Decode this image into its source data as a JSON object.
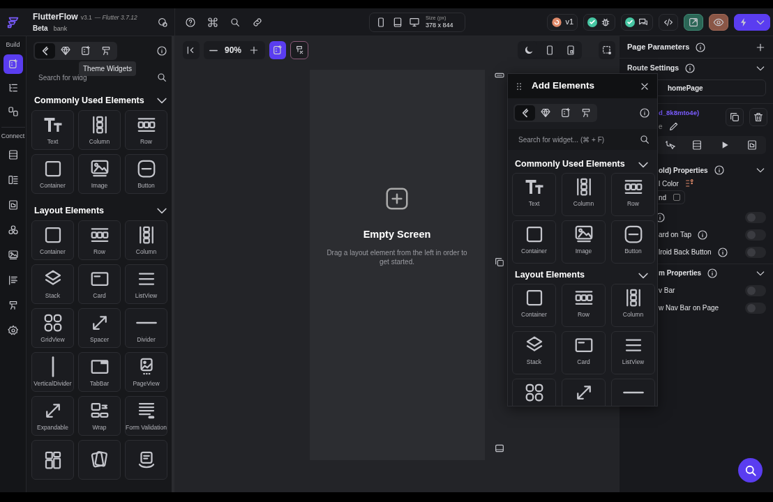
{
  "header": {
    "app_name": "FlutterFlow",
    "version": "v3.1",
    "flutter_version": "— Flutter 3.7.12",
    "tag": "Beta",
    "project": "bank"
  },
  "device_selector": {
    "size_label": "Size (px)",
    "size": "378 x 844"
  },
  "version_badge": "v1",
  "left_rail": [
    {
      "label": "Build",
      "items": [
        {
          "kind": "widgets",
          "selected": true
        },
        {
          "kind": "tree",
          "selected": false
        },
        {
          "kind": "storyboard",
          "selected": false
        }
      ]
    },
    {
      "label": "Connect",
      "items": [
        {
          "kind": "database",
          "selected": false
        },
        {
          "kind": "api",
          "selected": false
        },
        {
          "kind": "storage",
          "selected": false
        },
        {
          "kind": "integrations",
          "selected": false
        },
        {
          "kind": "media",
          "selected": false
        },
        {
          "kind": "content",
          "selected": false
        },
        {
          "kind": "theme",
          "selected": false
        },
        {
          "kind": "settings",
          "selected": false
        }
      ]
    }
  ],
  "widget_panel": {
    "tabs": [
      {
        "kind": "flutter",
        "selected": true
      },
      {
        "kind": "diamond",
        "selected": false
      },
      {
        "kind": "custom",
        "selected": false
      },
      {
        "kind": "theme",
        "selected": false
      }
    ],
    "tooltip": "Theme Widgets",
    "search": {
      "placeholder": "Search for widg"
    },
    "sections": [
      {
        "title": "Commonly Used Elements",
        "expanded": true,
        "items": [
          {
            "label": "Text",
            "kind": "text"
          },
          {
            "label": "Column",
            "kind": "column"
          },
          {
            "label": "Row",
            "kind": "row"
          },
          {
            "label": "Container",
            "kind": "container"
          },
          {
            "label": "Image",
            "kind": "image"
          },
          {
            "label": "Button",
            "kind": "button"
          }
        ]
      },
      {
        "title": "Layout Elements",
        "expanded": true,
        "items": [
          {
            "label": "Container",
            "kind": "container"
          },
          {
            "label": "Row",
            "kind": "row"
          },
          {
            "label": "Column",
            "kind": "column"
          },
          {
            "label": "Stack",
            "kind": "stack"
          },
          {
            "label": "Card",
            "kind": "card"
          },
          {
            "label": "ListView",
            "kind": "listview"
          },
          {
            "label": "GridView",
            "kind": "grid"
          },
          {
            "label": "Spacer",
            "kind": "spacer"
          },
          {
            "label": "Divider",
            "kind": "divider"
          },
          {
            "label": "VerticalDivider",
            "kind": "vdivider"
          },
          {
            "label": "TabBar",
            "kind": "tabbar"
          },
          {
            "label": "PageView",
            "kind": "pageview"
          },
          {
            "label": "Expandable",
            "kind": "expandable"
          },
          {
            "label": "Wrap",
            "kind": "wrap"
          },
          {
            "label": "Form Validation",
            "kind": "form"
          },
          {
            "kind": "staggered"
          },
          {
            "kind": "swipe"
          },
          {
            "kind": "carousel"
          }
        ]
      }
    ]
  },
  "canvas": {
    "zoom": "90%",
    "empty_title": "Empty Screen",
    "empty_text": "Drag a layout element from the left in order to get started."
  },
  "add_elements": {
    "title": "Add Elements",
    "tabs": [
      {
        "kind": "flutter",
        "selected": true
      },
      {
        "kind": "diamond",
        "selected": false
      },
      {
        "kind": "custom",
        "selected": false
      },
      {
        "kind": "theme",
        "selected": false
      }
    ],
    "search": {
      "placeholder": "Search for widget... (⌘ + F)"
    },
    "sections": [
      {
        "title": "Commonly Used Elements",
        "expanded": true,
        "items": [
          {
            "label": "Text",
            "kind": "text"
          },
          {
            "label": "Column",
            "kind": "column"
          },
          {
            "label": "Row",
            "kind": "row"
          },
          {
            "label": "Container",
            "kind": "container"
          },
          {
            "label": "Image",
            "kind": "image"
          },
          {
            "label": "Button",
            "kind": "button"
          }
        ]
      },
      {
        "title": "Layout Elements",
        "expanded": true,
        "items": [
          {
            "label": "Container",
            "kind": "container"
          },
          {
            "label": "Row",
            "kind": "row"
          },
          {
            "label": "Column",
            "kind": "column"
          },
          {
            "label": "Stack",
            "kind": "stack"
          },
          {
            "label": "Card",
            "kind": "card"
          },
          {
            "label": "ListView",
            "kind": "listview"
          },
          {
            "kind": "grid"
          },
          {
            "kind": "spacer"
          },
          {
            "kind": "divider"
          }
        ]
      }
    ]
  },
  "right_panel": {
    "page_parameters": "Page Parameters",
    "route_settings": "Route Settings",
    "route_name": "homePage",
    "widget_id": "d_8k8mto4e)",
    "widget_name": "e",
    "section_1": "old) Properties",
    "color_label": "l Color",
    "color_value": "nd",
    "toggles_1": [
      {
        "on": false
      },
      {
        "label": "ard on Tap",
        "on": false
      },
      {
        "label": "lroid Back Button",
        "on": false
      }
    ],
    "section_2": "m Properties",
    "toggles_2": [
      {
        "label": "v Bar",
        "on": false
      },
      {
        "label": "w Nav Bar on Page",
        "on": false
      }
    ]
  }
}
